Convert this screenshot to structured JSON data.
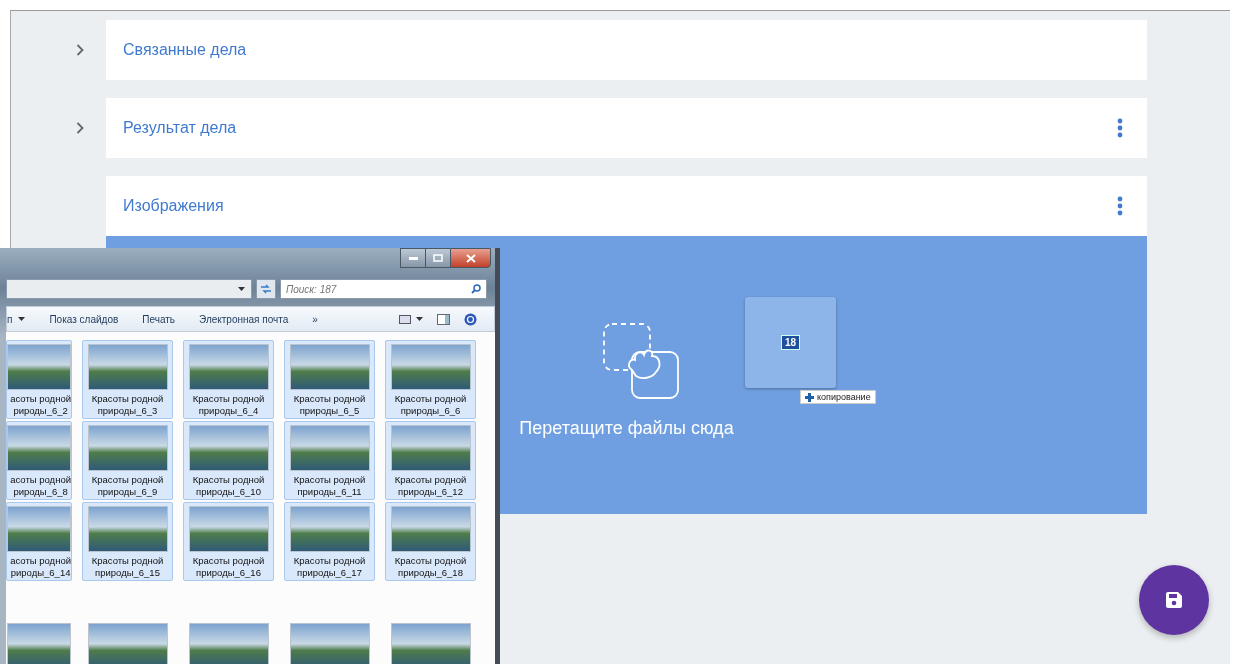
{
  "sections": [
    {
      "title": "Связанные дела",
      "expanded": false,
      "has_menu": false
    },
    {
      "title": "Результат дела",
      "expanded": false,
      "has_menu": true
    },
    {
      "title": "Изображения",
      "expanded": true,
      "has_menu": true
    }
  ],
  "dropzone": {
    "label": "Перетащите файлы сюда",
    "drag_count": "18",
    "drag_hint": "копирование"
  },
  "explorer": {
    "search": {
      "placeholder": "Поиск: 187"
    },
    "toolbar": [
      "п",
      "Показ слайдов",
      "Печать",
      "Электронная почта",
      "»"
    ],
    "files": [
      {
        "line1": "асоты родной",
        "line2": "рироды_6_2",
        "selected": true
      },
      {
        "line1": "Красоты родной",
        "line2": "природы_6_3",
        "selected": true
      },
      {
        "line1": "Красоты родной",
        "line2": "природы_6_4",
        "selected": true
      },
      {
        "line1": "Красоты родной",
        "line2": "природы_6_5",
        "selected": true
      },
      {
        "line1": "Красоты родной",
        "line2": "природы_6_6",
        "selected": true
      },
      {
        "line1": "асоты родной",
        "line2": "рироды_6_8",
        "selected": true
      },
      {
        "line1": "Красоты родной",
        "line2": "природы_6_9",
        "selected": true
      },
      {
        "line1": "Красоты родной",
        "line2": "природы_6_10",
        "selected": true
      },
      {
        "line1": "Красоты родной",
        "line2": "природы_6_11",
        "selected": true
      },
      {
        "line1": "Красоты родной",
        "line2": "природы_6_12",
        "selected": true
      },
      {
        "line1": "асоты родной",
        "line2": "рироды_6_14",
        "selected": true
      },
      {
        "line1": "Красоты родной",
        "line2": "природы_6_15",
        "selected": true
      },
      {
        "line1": "Красоты родной",
        "line2": "природы_6_16",
        "selected": true
      },
      {
        "line1": "Красоты родной",
        "line2": "природы_6_17",
        "selected": true
      },
      {
        "line1": "Красоты родной",
        "line2": "природы_6_18",
        "selected": true
      },
      {
        "selected": false
      },
      {
        "selected": false
      },
      {
        "selected": false
      },
      {
        "selected": false
      },
      {
        "selected": false
      }
    ]
  }
}
